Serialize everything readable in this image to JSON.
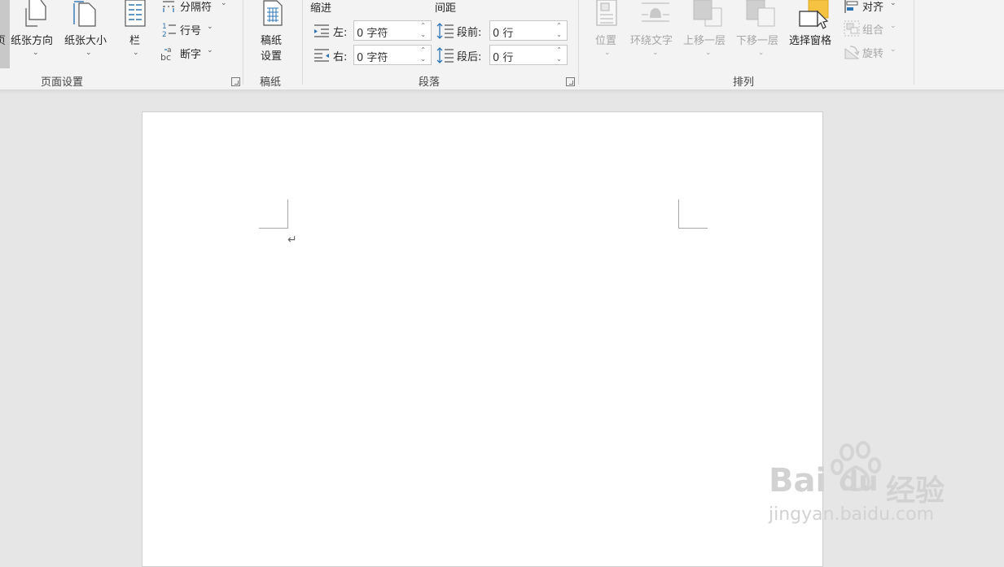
{
  "ribbon": {
    "page_setup": {
      "partial_button_char": "页",
      "orientation_label": "纸张方向",
      "size_label": "纸张大小",
      "columns_label": "栏",
      "breaks_label": "分隔符",
      "line_numbers_label": "行号",
      "hyphenation_label": "断字",
      "group_label": "页面设置"
    },
    "manuscript": {
      "button_label_line1": "稿纸",
      "button_label_line2": "设置",
      "group_label": "稿纸"
    },
    "paragraph": {
      "indent_header": "缩进",
      "spacing_header": "间距",
      "indent_left_label": "左:",
      "indent_left_value": "0 字符",
      "indent_right_label": "右:",
      "indent_right_value": "0 字符",
      "spacing_before_label": "段前:",
      "spacing_before_value": "0 行",
      "spacing_after_label": "段后:",
      "spacing_after_value": "0 行",
      "group_label": "段落"
    },
    "arrange": {
      "position_label": "位置",
      "wrap_text_label": "环绕文字",
      "bring_forward_label": "上移一层",
      "send_backward_label": "下移一层",
      "selection_pane_label": "选择窗格",
      "align_label": "对齐",
      "group_label_action": "组合",
      "rotate_label": "旋转",
      "group_label": "排列"
    }
  },
  "document": {
    "paragraph_mark": "↵"
  },
  "watermark": {
    "brand": "Bai",
    "brand_tail": "du",
    "cn": "经验",
    "url": "jingyan.baidu.com"
  },
  "colors": {
    "accent": "#2b579a",
    "icon_blue": "#2e75b6",
    "selection_yellow": "#f5c242",
    "disabled": "#a6a6a6"
  }
}
